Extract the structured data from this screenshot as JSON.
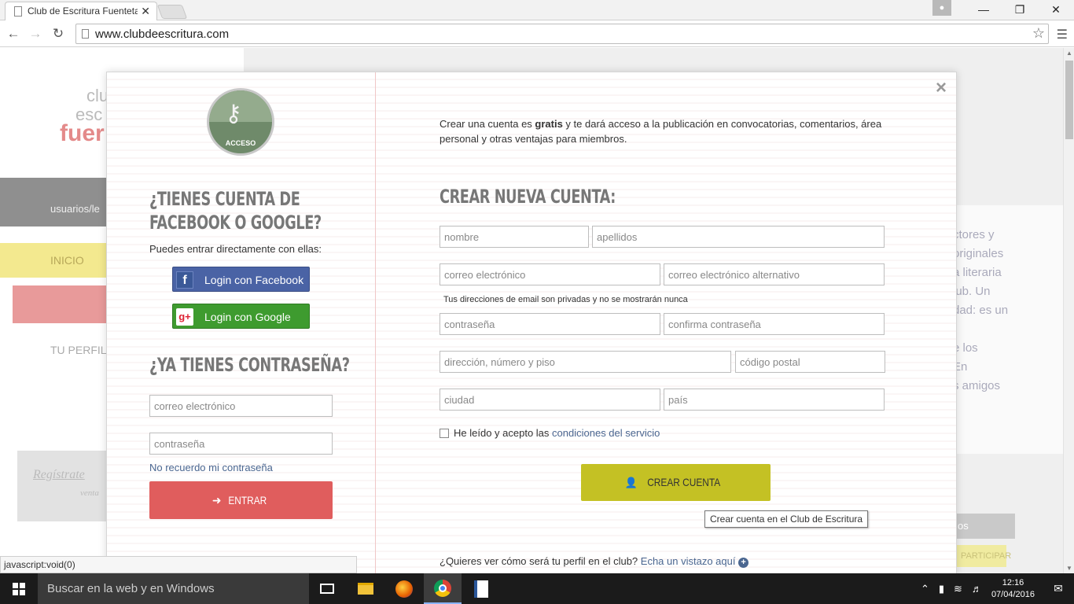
{
  "browser": {
    "tab_title": "Club de Escritura Fuenteta",
    "tab_close": "✕",
    "url": "www.clubdeescritura.com",
    "status_text": "javascript:void(0)"
  },
  "background": {
    "logo_line1": "clu",
    "logo_line2": "esc",
    "logo_line3": "fuer",
    "users": "usuarios/le",
    "nav_inicio": "INICIO",
    "nav_perfil": "TU PERFIL",
    "register": "Regístrate",
    "register_sub": "venta",
    "right_text": [
      "ctores y",
      "originales",
      "a literaria",
      "lub. Un",
      "dad: es un",
      "",
      "e los",
      "En",
      "s amigos"
    ],
    "right_box": "os",
    "right_participar": "PARTICIPAR"
  },
  "modal": {
    "close": "×",
    "badge_label": "ACCESO",
    "social_heading_line1": "¿TIENES CUENTA DE",
    "social_heading_line2": "FACEBOOK O GOOGLE?",
    "social_sub": "Puedes entrar directamente con ellas:",
    "facebook_button": "Login con Facebook",
    "google_button": "Login con Google",
    "password_heading": "¿YA TIENES CONTRASEÑA?",
    "login_email_placeholder": "correo electrónico",
    "login_password_placeholder": "contraseña",
    "forgot_link": "No recuerdo mi contraseña",
    "entrar_button": "ENTRAR",
    "intro_part1": "Crear una cuenta es ",
    "intro_bold": "gratis",
    "intro_part2": " y te dará acceso a la publicación en convocatorias, comentarios, área personal y otras ventajas para miembros.",
    "create_heading": "CREAR NUEVA CUENTA:",
    "placeholders": {
      "nombre": "nombre",
      "apellidos": "apellidos",
      "correo": "correo electrónico",
      "correo_alt": "correo electrónico alternativo",
      "contrasena": "contraseña",
      "confirma": "confirma contraseña",
      "direccion": "dirección, número y piso",
      "cp": "código postal",
      "ciudad": "ciudad",
      "pais": "país"
    },
    "email_note": "Tus direcciones de email son privadas y no se mostrarán nunca",
    "terms_text": "He leído y acepto las ",
    "terms_link": "condiciones del servicio",
    "create_button": "CREAR CUENTA",
    "tooltip": "Crear cuenta en el Club de Escritura",
    "profile_question": "¿Quieres ver cómo será tu perfil en el club? ",
    "profile_link": "Echa un vistazo aquí"
  },
  "taskbar": {
    "search_placeholder": "Buscar en la web y en Windows",
    "time": "12:16",
    "date": "07/04/2016"
  },
  "colors": {
    "entrar": "#e05d5d",
    "crear": "#c4c124",
    "facebook": "#4a63a5",
    "google": "#3e9b2f",
    "link": "#4a6690"
  }
}
